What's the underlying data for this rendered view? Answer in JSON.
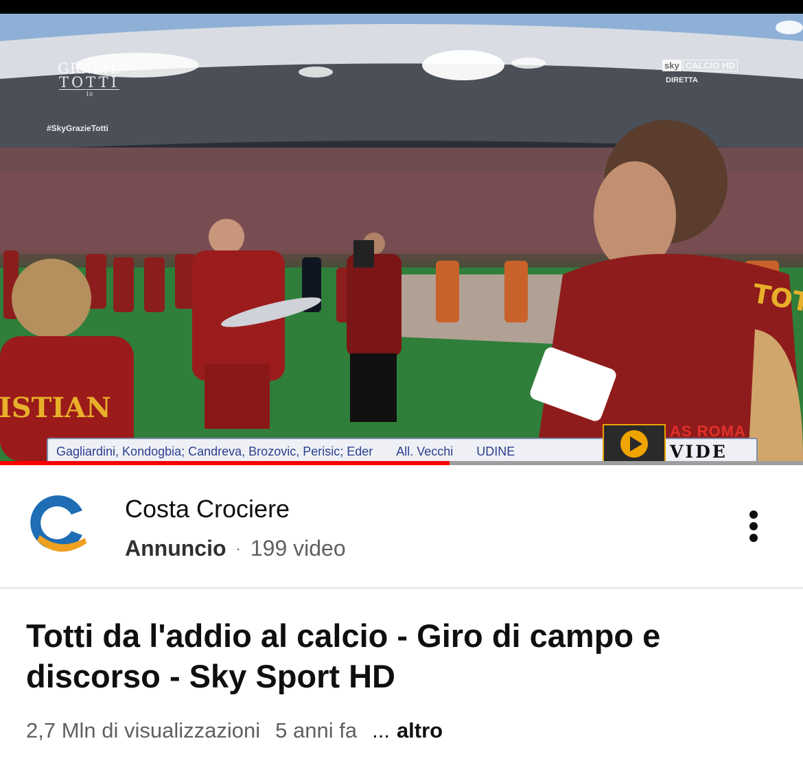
{
  "player": {
    "overlay_brand": {
      "line1": "GRAZIE",
      "line2": "TOTTI",
      "line3": "10"
    },
    "overlay_hashtag": "#SkyGrazieTotti",
    "channel_logo": {
      "sky": "sky",
      "calcio": "CALCIO HD"
    },
    "channel_status": "DIRETTA",
    "ticker": {
      "lineup": "Gagliardini, Kondogbia; Candreva, Brozovic, Perisic; Eder",
      "coach": "All. Vecchi",
      "team": "UDINE"
    },
    "watermark": {
      "title": "AS ROMA",
      "subtitle": "VIDE"
    },
    "jersey_name_left": "ISTIAN",
    "jersey_name_right": "TOTTI",
    "progress": 0.56
  },
  "channel": {
    "name": "Costa Crociere",
    "ad_label": "Annuncio",
    "separator": "·",
    "video_count": "199 video",
    "colors": {
      "blue": "#1e6db5",
      "orange": "#f0a020"
    }
  },
  "video": {
    "title": "Totti da l'addio al calcio - Giro di campo e discorso - Sky Sport HD",
    "views": "2,7 Mln di visualizzazioni",
    "age": "5 anni fa",
    "ellipsis": "...",
    "more": "altro"
  },
  "colors": {
    "progress": "#ff0000",
    "title_text": "#0f0f0f",
    "meta_text": "#606060"
  }
}
